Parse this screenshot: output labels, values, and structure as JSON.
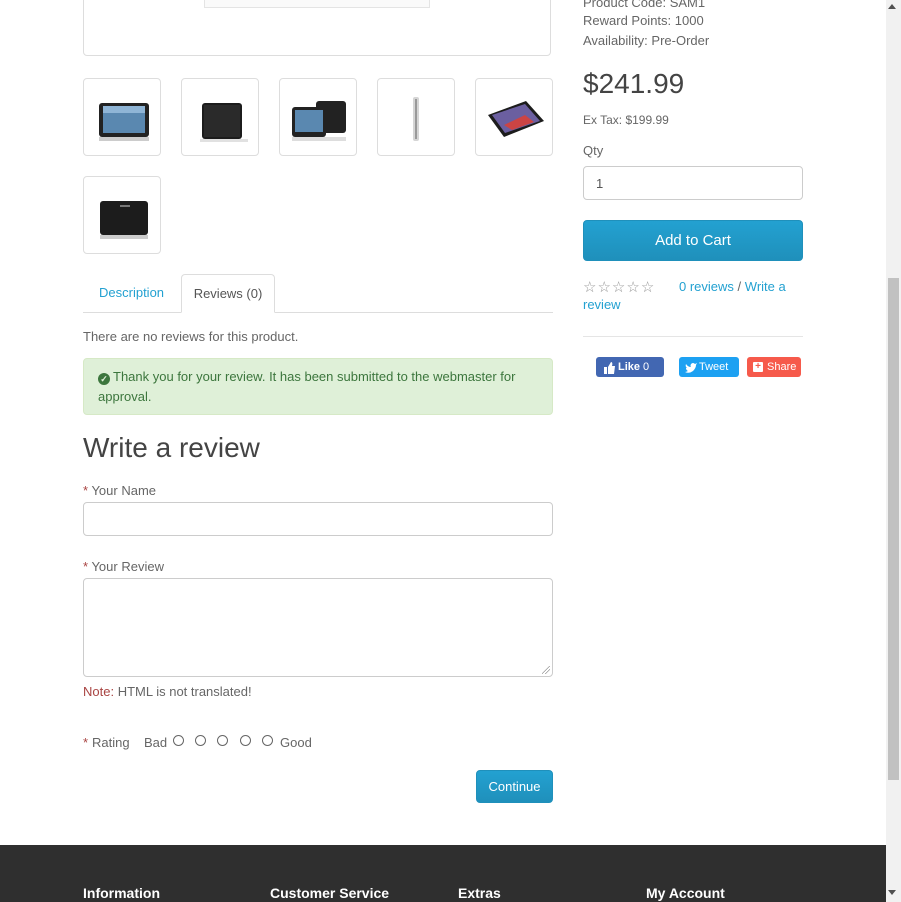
{
  "product_info": {
    "code": "Product Code: SAM1",
    "reward": "Reward Points: 1000",
    "availability": "Availability: Pre-Order"
  },
  "price": "$241.99",
  "ex_tax": "Ex Tax: $199.99",
  "qty": {
    "label": "Qty",
    "value": "1"
  },
  "add_to_cart": "Add to Cart",
  "reviews_summary": {
    "count_link": "0 reviews",
    "separator": "/",
    "write_link_a": "Write a",
    "write_link_b": "review"
  },
  "social": {
    "like": "Like",
    "like_count": "0",
    "tweet": "Tweet",
    "share": "Share"
  },
  "tabs": [
    {
      "label": "Description"
    },
    {
      "label": "Reviews (0)"
    }
  ],
  "no_reviews": "There are no reviews for this product.",
  "alert": "Thank you for your review. It has been submitted to the webmaster for approval.",
  "write_review": {
    "title": "Write a review",
    "required_mark": "*",
    "name_label": "Your Name",
    "name_value": "",
    "review_label": "Your Review",
    "review_value": "",
    "note_prefix": "Note:",
    "note_text": " HTML is not translated!",
    "rating_label": "Rating",
    "rating_bad": "Bad",
    "rating_good": "Good",
    "continue": "Continue"
  },
  "footer": {
    "columns": [
      {
        "title": "Information"
      },
      {
        "title": "Customer Service"
      },
      {
        "title": "Extras"
      },
      {
        "title": "My Account"
      }
    ]
  },
  "icons": {
    "check": "check-circle-icon",
    "star": "star-outline-icon",
    "facebook": "facebook-thumb-icon",
    "twitter": "twitter-bird-icon",
    "share": "share-plus-icon"
  },
  "colors": {
    "accent": "#23a1d1",
    "success_bg": "#dff0d8",
    "success_text": "#3c763d",
    "required": "#a94442",
    "footer_bg": "#2f2f2f"
  }
}
